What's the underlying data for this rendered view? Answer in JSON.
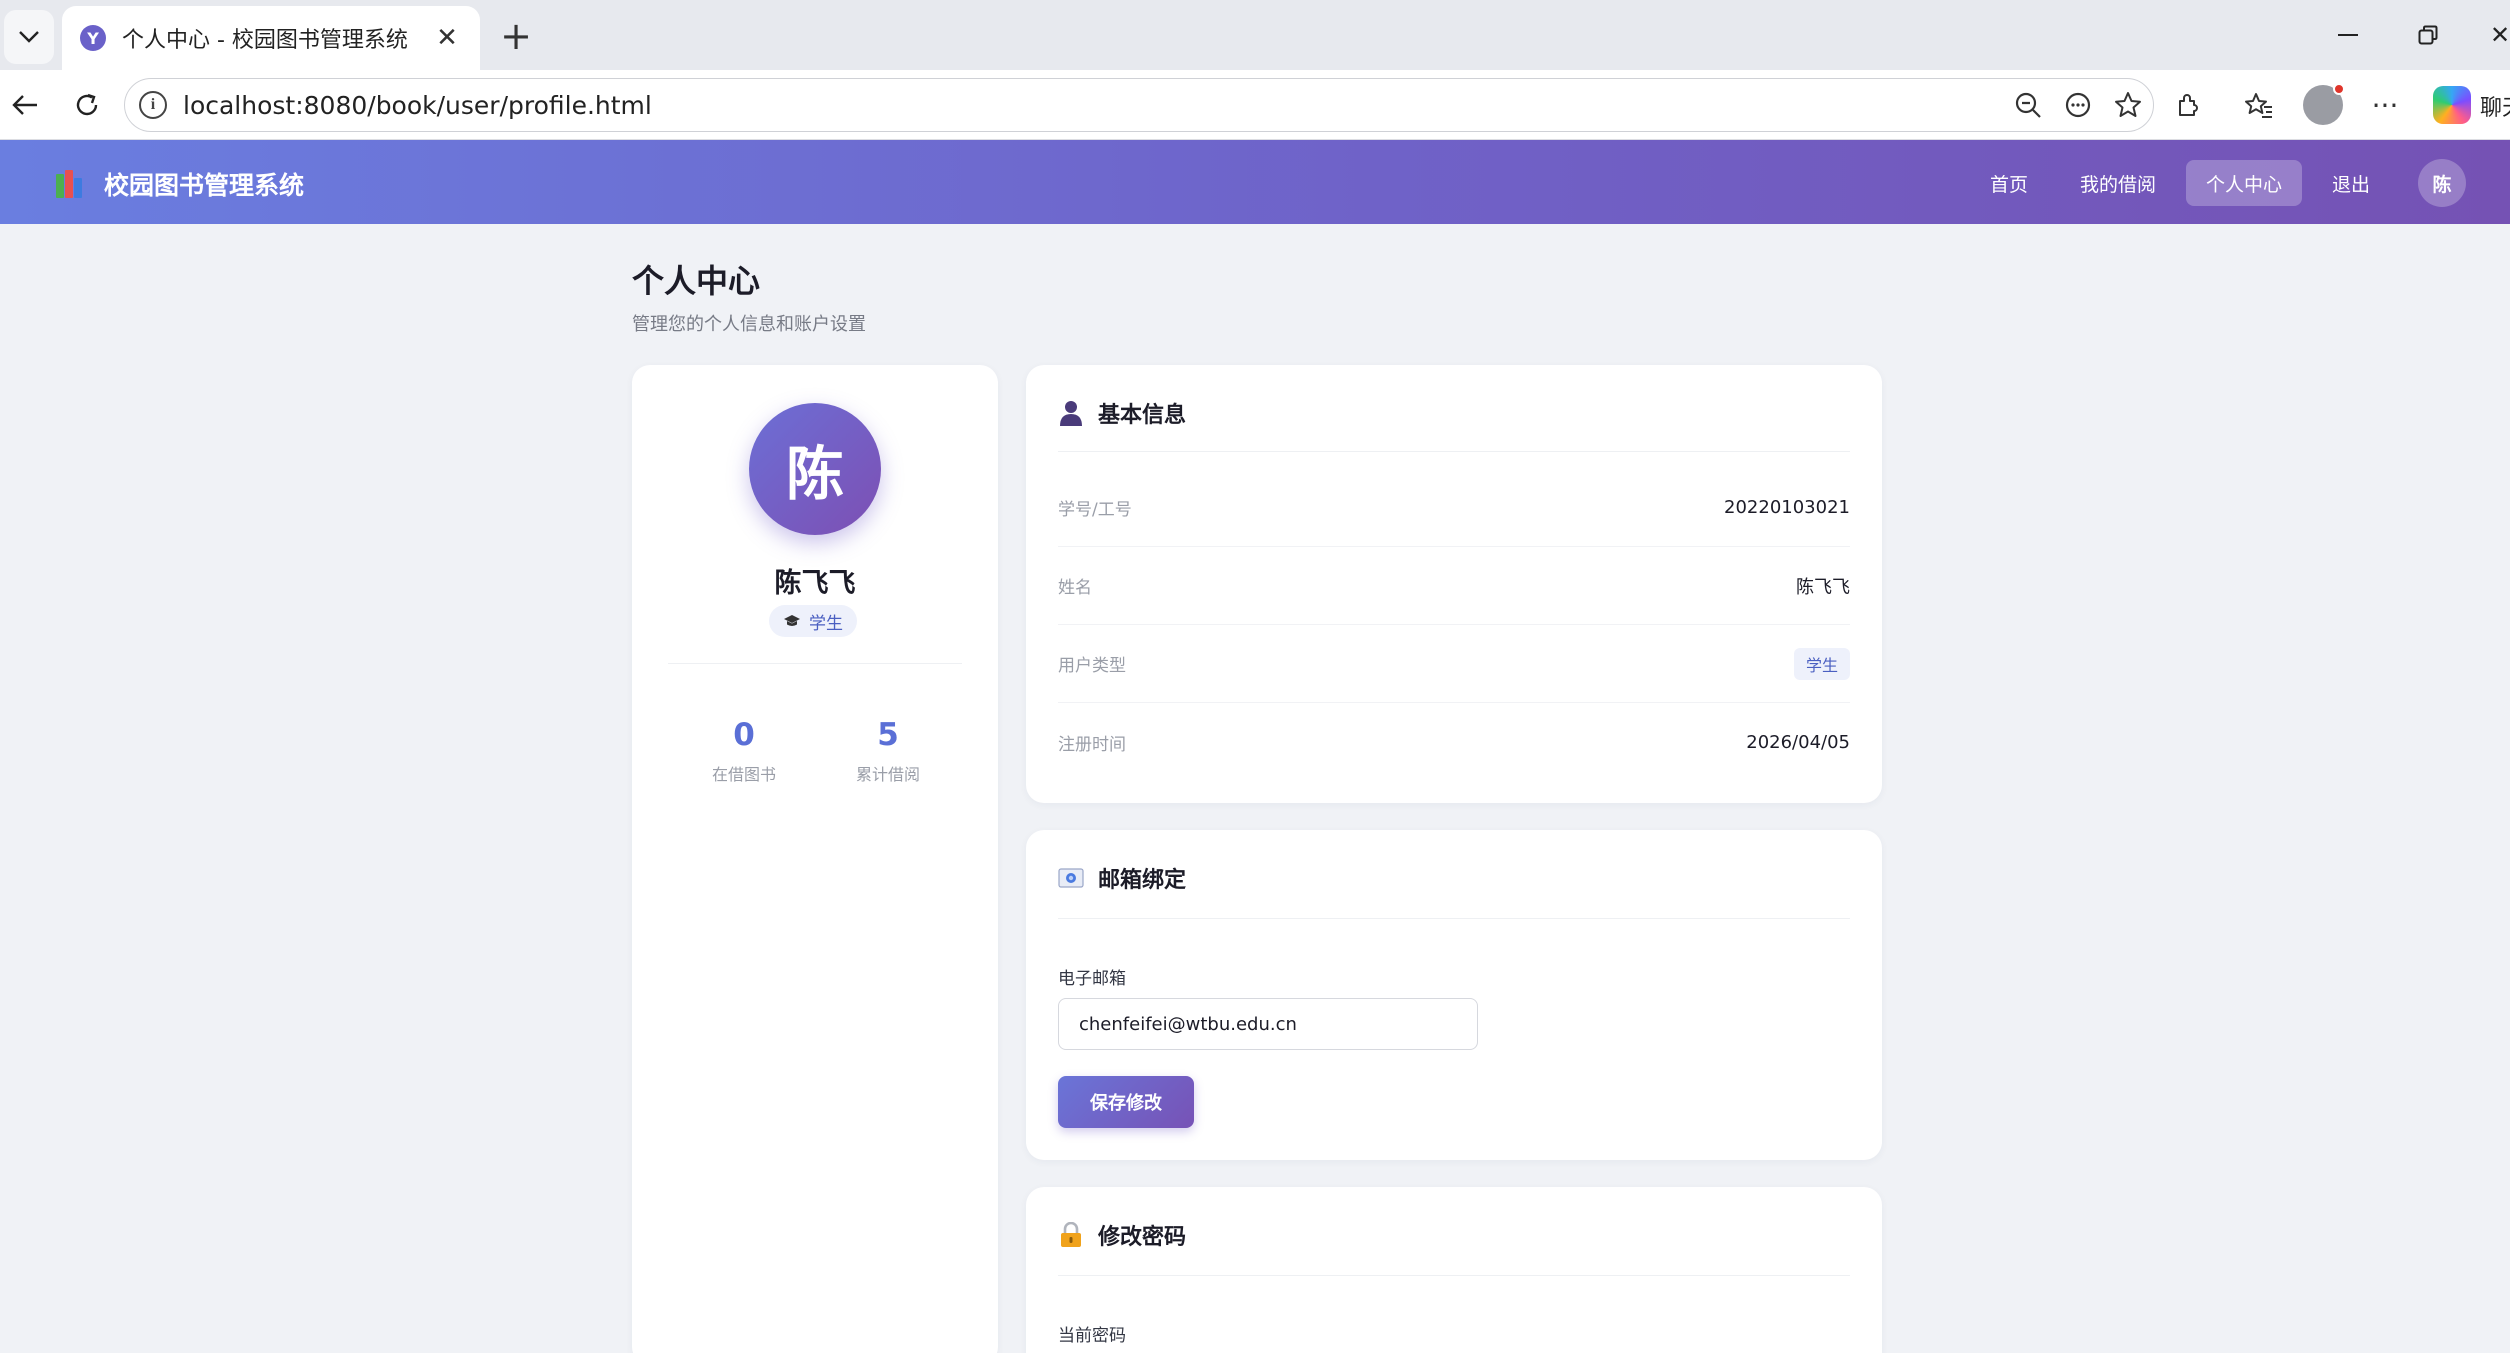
{
  "browser": {
    "tab_title": "个人中心 - 校园图书管理系统",
    "tab_favicon": "Y",
    "url": "localhost:8080/book/user/profile.html",
    "side_panel_label": "聊天"
  },
  "app": {
    "brand": "校园图书管理系统",
    "nav": {
      "home": "首页",
      "borrows": "我的借阅",
      "profile": "个人中心",
      "logout": "退出"
    },
    "user_initial": "陈",
    "accent_color": "#6f62c8"
  },
  "page": {
    "title": "个人中心",
    "subtitle": "管理您的个人信息和账户设置"
  },
  "profile_card": {
    "avatar_initial": "陈",
    "name": "陈飞飞",
    "role": "学生",
    "role_icon": "graduation-cap-icon",
    "stats": [
      {
        "value": "0",
        "label": "在借图书"
      },
      {
        "value": "5",
        "label": "累计借阅"
      }
    ]
  },
  "basic_info": {
    "title": "基本信息",
    "icon": "user-icon",
    "rows": [
      {
        "label": "学号/工号",
        "value": "20220103021"
      },
      {
        "label": "姓名",
        "value": "陈飞飞"
      },
      {
        "label": "用户类型",
        "value": "学生"
      },
      {
        "label": "注册时间",
        "value": "2026/04/05"
      }
    ]
  },
  "email_binding": {
    "title": "邮箱绑定",
    "icon": "email-icon",
    "field_label": "电子邮箱",
    "email_value": "chenfeifei@wtbu.edu.cn",
    "save_label": "保存修改"
  },
  "change_password": {
    "title": "修改密码",
    "icon": "lock-icon",
    "current_password_label": "当前密码"
  }
}
